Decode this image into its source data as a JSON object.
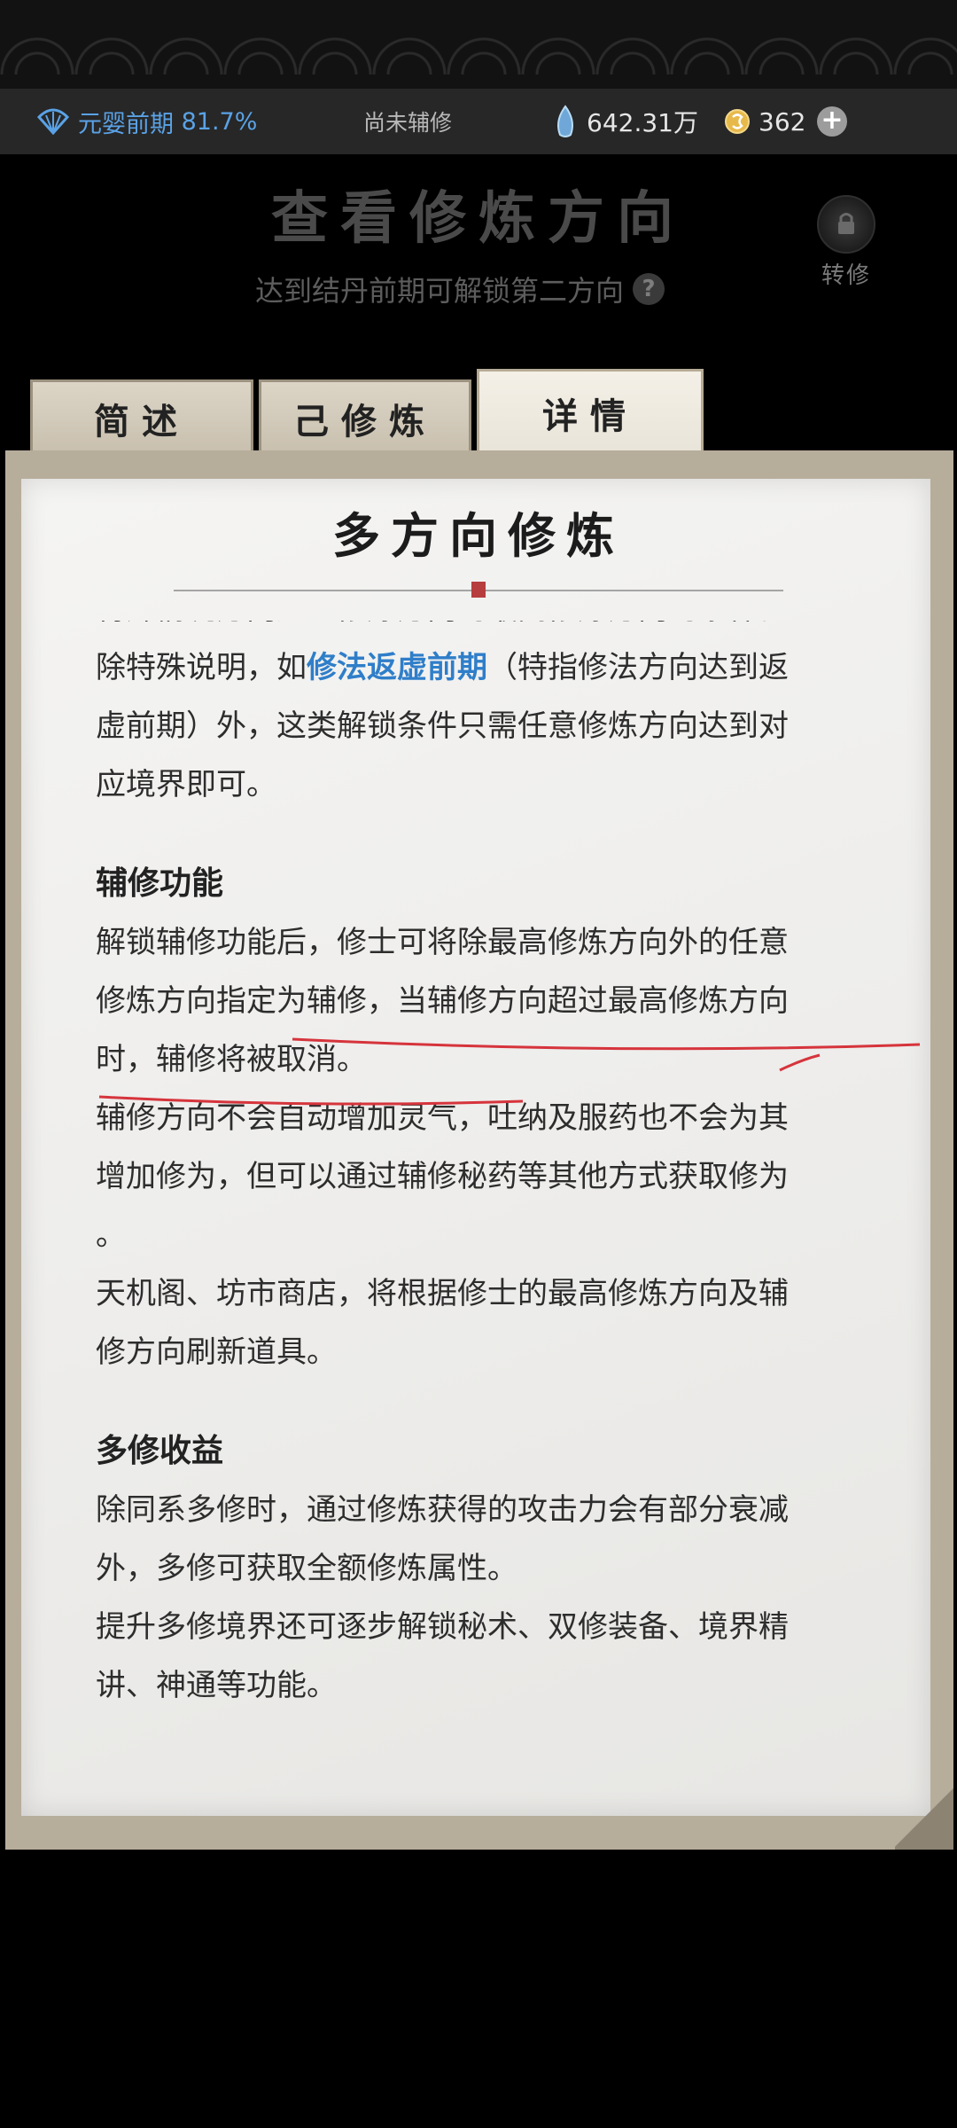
{
  "status_bar": {
    "realm_label": "元婴前期",
    "realm_progress": "81.7%",
    "aux_status": "尚未辅修",
    "spirit_stones": "642.31万",
    "coins": "362",
    "accent_color": "#5aa2e6"
  },
  "header": {
    "title": "查看修炼方向",
    "unlock_hint": "达到结丹前期可解锁第二方向",
    "help_glyph": "?",
    "transfer_label": "转修"
  },
  "tabs": [
    {
      "label": "简述",
      "selected": false
    },
    {
      "label": "己修炼",
      "selected": false
    },
    {
      "label": "详情",
      "selected": true
    }
  ],
  "panel": {
    "title": "多方向修炼",
    "partial_top_line": "特殊情况方向达到修炼方向的最高修炼方向的条件。",
    "para1_prefix": "除特殊说明，如",
    "para1_link": "修法返虚前期",
    "para1_rest_line1": "（特指修法方向达到返",
    "para1_rest_line2": "虚前期）外，这类解锁条件只需任意修炼方向达到对",
    "para1_rest_line3": "应境界即可。",
    "section1_heading": "辅修功能",
    "section1_p1_line1": "解锁辅修功能后，修士可将除最高修炼方向外的任意",
    "section1_p1_line2": "修炼方向指定为辅修，当辅修方向超过最高修炼方向",
    "section1_p1_line3": "时，辅修将被取消。",
    "section1_p2_line1": "辅修方向不会自动增加灵气，吐纳及服药也不会为其",
    "section1_p2_line2": "增加修为，但可以通过辅修秘药等其他方式获取修为",
    "section1_p2_line3": "。",
    "section1_p3_line1": "天机阁、坊市商店，将根据修士的最高修炼方向及辅",
    "section1_p3_line2": "修方向刷新道具。",
    "section2_heading": "多修收益",
    "section2_p1_line1": "除同系多修时，通过修炼获得的攻击力会有部分衰减",
    "section2_p1_line2": "外，多修可获取全额修炼属性。",
    "section2_p2_line1": "提升多修境界还可逐步解锁秘术、双修装备、境界精",
    "section2_p2_line2": "讲、神通等功能。"
  },
  "colors": {
    "link": "#2f7ec9",
    "annotation_red": "#d6343c"
  }
}
